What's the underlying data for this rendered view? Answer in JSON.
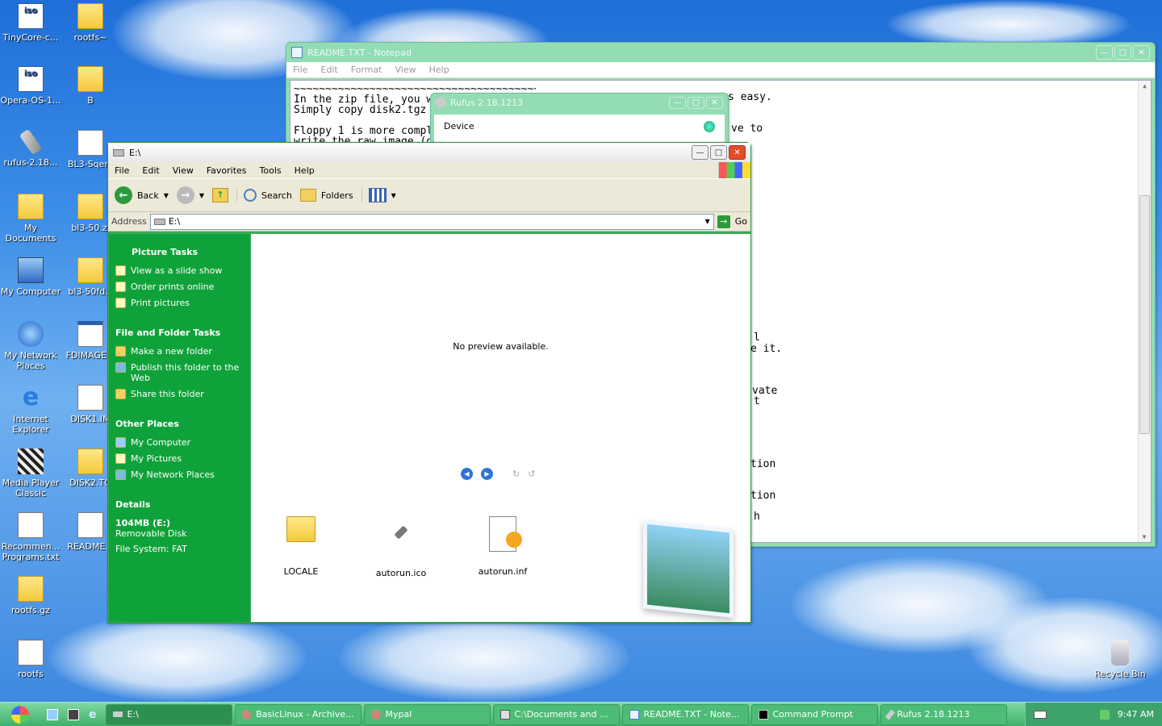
{
  "desktop": {
    "icons": [
      {
        "label": "TinyCore-c...",
        "type": "iso"
      },
      {
        "label": "rootfs~",
        "type": "folder"
      },
      {
        "label": "Opera-OS-1...",
        "type": "iso"
      },
      {
        "label": "B",
        "type": "folder"
      },
      {
        "label": "rufus-2.18...",
        "type": "usb"
      },
      {
        "label": "BL3-Sqem",
        "type": "doc"
      },
      {
        "label": "My Documents",
        "type": "folder"
      },
      {
        "label": "bl3-50.zi",
        "type": "zip"
      },
      {
        "label": "My Computer",
        "type": "computer"
      },
      {
        "label": "bl3-50fd.z",
        "type": "zip"
      },
      {
        "label": "My Network Places",
        "type": "network"
      },
      {
        "label": "FDIMAGE.E",
        "type": "window"
      },
      {
        "label": "Internet Explorer",
        "type": "ie"
      },
      {
        "label": "DISK1.IM",
        "type": "doc"
      },
      {
        "label": "Media Player Classic",
        "type": "media"
      },
      {
        "label": "DISK2.TG",
        "type": "gz"
      },
      {
        "label": "Recommen... Programs.txt",
        "type": "doc"
      },
      {
        "label": "README.T",
        "type": "doc"
      },
      {
        "label": "rootfs.gz",
        "type": "gz"
      },
      {
        "label": "rootfs",
        "type": "doc"
      },
      {
        "label": "Recycle Bin",
        "type": "recycle"
      }
    ]
  },
  "notepad": {
    "title": "README.TXT - Notepad",
    "menu": [
      "File",
      "Edit",
      "Format",
      "View",
      "Help"
    ],
    "lines": [
      "~~~~~~~~~~~~~~~~~~~~~~~~~~~~~~~~~~~~~~~~~~",
      "In the zip file, you w",
      "Simply copy disk2.tgz",
      "",
      "Floppy 1 is more compl",
      "write the raw image (d"
    ],
    "right_fragments": [
      "s easy.",
      "ve to",
      "l",
      "e it.",
      "vate",
      "t",
      "tion",
      "tion",
      "h"
    ]
  },
  "rufus": {
    "title": "Rufus 2.18.1213",
    "device_label": "Device"
  },
  "explorer": {
    "title": "E:\\",
    "menu": [
      "File",
      "Edit",
      "View",
      "Favorites",
      "Tools",
      "Help"
    ],
    "toolbar": {
      "back": "Back",
      "search": "Search",
      "folders": "Folders"
    },
    "address_label": "Address",
    "address_value": "E:\\",
    "go_label": "Go",
    "picture_tasks": {
      "heading": "Picture Tasks",
      "items": [
        "View as a slide show",
        "Order prints online",
        "Print pictures"
      ]
    },
    "file_tasks": {
      "heading": "File and Folder Tasks",
      "items": [
        "Make a new folder",
        "Publish this folder to the Web",
        "Share this folder"
      ]
    },
    "other_places": {
      "heading": "Other Places",
      "items": [
        "My Computer",
        "My Pictures",
        "My Network Places"
      ]
    },
    "details": {
      "heading": "Details",
      "name": "104MB (E:)",
      "type": "Removable Disk",
      "fs": "File System: FAT"
    },
    "preview_text": "No preview available.",
    "files": [
      {
        "name": "LOCALE",
        "type": "folder"
      },
      {
        "name": "autorun.ico",
        "type": "usb"
      },
      {
        "name": "autorun.inf",
        "type": "settings"
      }
    ]
  },
  "taskbar": {
    "items": [
      {
        "label": "E:\\",
        "active": true
      },
      {
        "label": "BasicLinux - Archive...",
        "active": false
      },
      {
        "label": "Mypal",
        "active": false
      },
      {
        "label": "C:\\Documents and ...",
        "active": false
      },
      {
        "label": "README.TXT - Note...",
        "active": false
      },
      {
        "label": "Command Prompt",
        "active": false
      },
      {
        "label": "Rufus 2.18.1213",
        "active": false
      }
    ],
    "clock": "9:47 AM"
  }
}
